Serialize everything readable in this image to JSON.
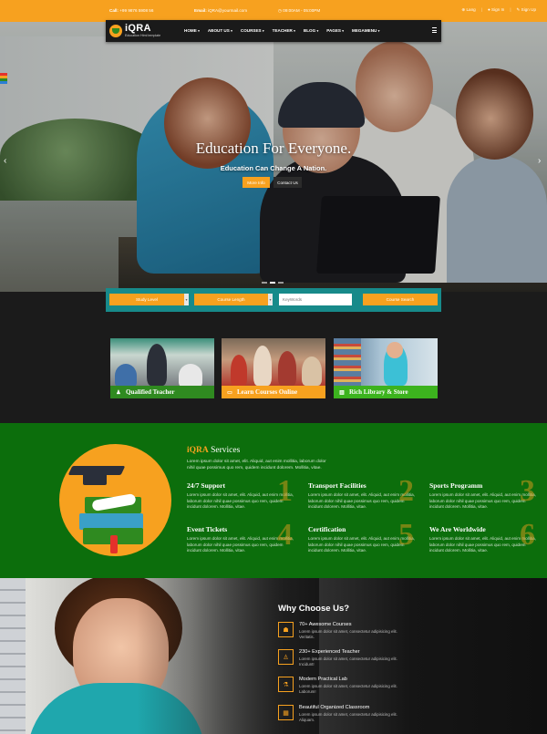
{
  "topbar": {
    "phone_label": "Call:",
    "phone": "+99 9876 5908 56",
    "email_label": "Email:",
    "email": "iQRA@yourmail.com",
    "hours": "09:00AM - 05:00PM",
    "lang": "Lang",
    "sign_in": "Sign In",
    "sign_up": "Sign Up"
  },
  "nav": {
    "logo_name": "iQRA",
    "logo_tag": "Education Html template",
    "items": [
      "HOME",
      "ABOUT US",
      "COURSES",
      "TEACHER",
      "BLOG",
      "PAGES",
      "MEGAMENU"
    ]
  },
  "hero": {
    "title": "Education For Everyone.",
    "subtitle": "Education Can Change A Nation.",
    "more_info": "More Info",
    "contact_us": "Contact Us"
  },
  "search": {
    "study_level": "Study Level",
    "course_length": "Course Length",
    "keywords_placeholder": "KeyWords",
    "button": "Course Search"
  },
  "features": [
    {
      "label": "Qualified Teacher"
    },
    {
      "label": "Learn Courses Online"
    },
    {
      "label": "Rich Library & Store"
    }
  ],
  "services": {
    "title_brand": "iQRA",
    "title_rest": "Services",
    "intro": "Lorem ipsum dolor sit amet, elit. Aliquid, aut enim mollitia, laborum dolor nihil quae possimus quo rem, quidem incidunt dolorem. Mollitia, vitae.",
    "items": [
      {
        "title": "24/7 Support",
        "num": "1",
        "desc": "Lorem ipsum dolor sit amet, elit. Aliquid, aut enim mollitia, laborum dolor nihil quae possimus quo rem, quidem incidunt dolorem. Mollitia, vitae."
      },
      {
        "title": "Transport Facilities",
        "num": "2",
        "desc": "Lorem ipsum dolor sit amet, elit. Aliquid, aut enim mollitia, laborum dolor nihil quae possimus quo rem, quidem incidunt dolorem. Mollitia, vitae."
      },
      {
        "title": "Sports Programm",
        "num": "3",
        "desc": "Lorem ipsum dolor sit amet, elit. Aliquid, aut enim mollitia, laborum dolor nihil quae possimus quo rem, quidem incidunt dolorem. Mollitia, vitae."
      },
      {
        "title": "Event Tickets",
        "num": "4",
        "desc": "Lorem ipsum dolor sit amet, elit. Aliquid, aut enim mollitia, laborum dolor nihil quae possimus quo rem, quidem incidunt dolorem. Mollitia, vitae."
      },
      {
        "title": "Certification",
        "num": "5",
        "desc": "Lorem ipsum dolor sit amet, elit. Aliquid, aut enim mollitia, laborum dolor nihil quae possimus quo rem, quidem incidunt dolorem. Mollitia, vitae."
      },
      {
        "title": "We Are Worldwide",
        "num": "6",
        "desc": "Lorem ipsum dolor sit amet, elit. Aliquid, aut enim mollitia, laborum dolor nihil quae possimus quo rem, quidem incidunt dolorem. Mollitia, vitae."
      }
    ]
  },
  "why": {
    "title": "Why Choose Us?",
    "items": [
      {
        "title": "70+ Awesome Courses",
        "desc": "Lorem ipsum dolor sit amet, consectetur adipisicing elit. Veritatis."
      },
      {
        "title": "230+ Experienced Teacher",
        "desc": "Lorem ipsum dolor sit amet, consectetur adipisicing elit. Incidunt!"
      },
      {
        "title": "Modern Practical Lab",
        "desc": "Lorem ipsum dolor sit amet, consectetur adipisicing elit. Laborum!"
      },
      {
        "title": "Beautiful Organized Classroom",
        "desc": "Lorem ipsum dolor sit amet, consectetur adipisicing elit. Aliquam."
      }
    ]
  },
  "colors": {
    "accent": "#f7a11f",
    "green": "#0c6e0c",
    "teal": "#178a8a",
    "dark": "#1b1b1b"
  }
}
